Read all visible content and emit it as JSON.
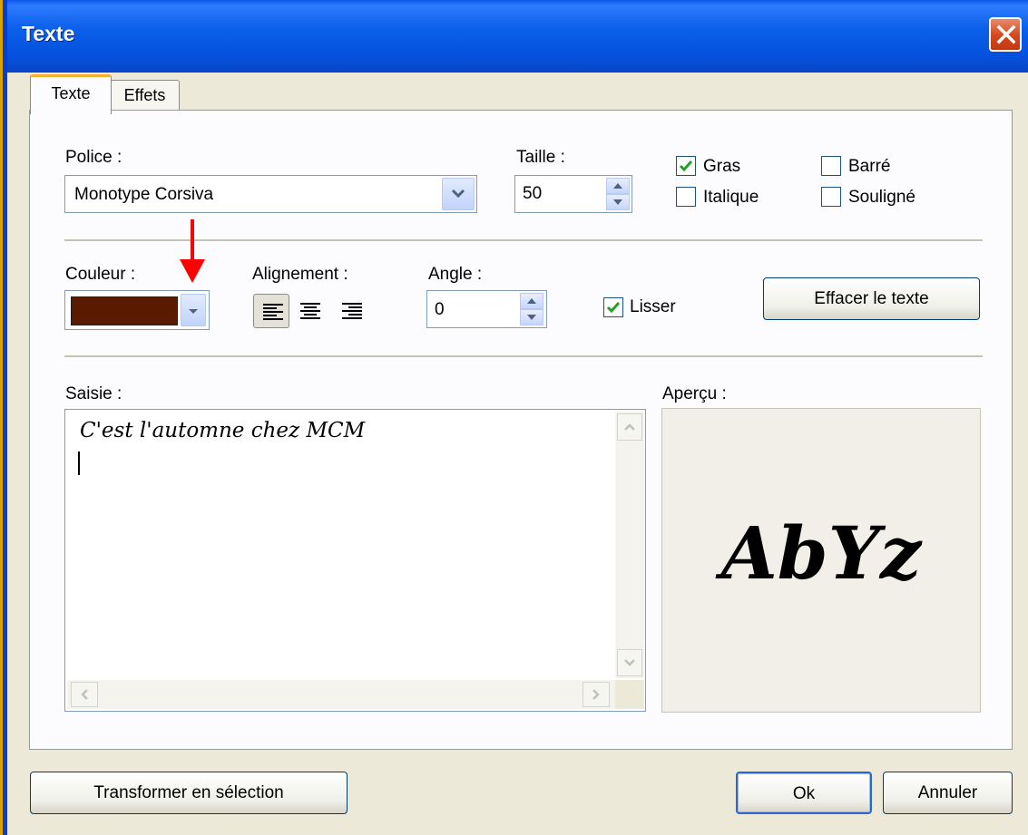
{
  "window": {
    "title": "Texte"
  },
  "tabs": [
    {
      "label": "Texte",
      "active": true
    },
    {
      "label": "Effets",
      "active": false
    }
  ],
  "police": {
    "label": "Police :",
    "value": "Monotype Corsiva"
  },
  "taille": {
    "label": "Taille :",
    "value": "50"
  },
  "styles": {
    "gras": {
      "label": "Gras",
      "checked": true
    },
    "italique": {
      "label": "Italique",
      "checked": false
    },
    "barre": {
      "label": "Barré",
      "checked": false
    },
    "souligne": {
      "label": "Souligné",
      "checked": false
    }
  },
  "couleur": {
    "label": "Couleur :",
    "value": "#5a1a00"
  },
  "alignement": {
    "label": "Alignement :",
    "options": [
      "left",
      "center",
      "right"
    ],
    "selected": "left"
  },
  "angle": {
    "label": "Angle :",
    "value": "0"
  },
  "lisser": {
    "label": "Lisser",
    "checked": true
  },
  "effacer_button": "Effacer le texte",
  "saisie": {
    "label": "Saisie :",
    "text": "C'est l'automne chez MCM"
  },
  "apercu": {
    "label": "Aperçu :",
    "sample": "AbYz"
  },
  "buttons": {
    "transformer": "Transformer en sélection",
    "ok": "Ok",
    "annuler": "Annuler"
  },
  "colors": {
    "titlebar": "#0550dc",
    "check": "#21a121",
    "annotation_arrow": "#ff0000"
  }
}
